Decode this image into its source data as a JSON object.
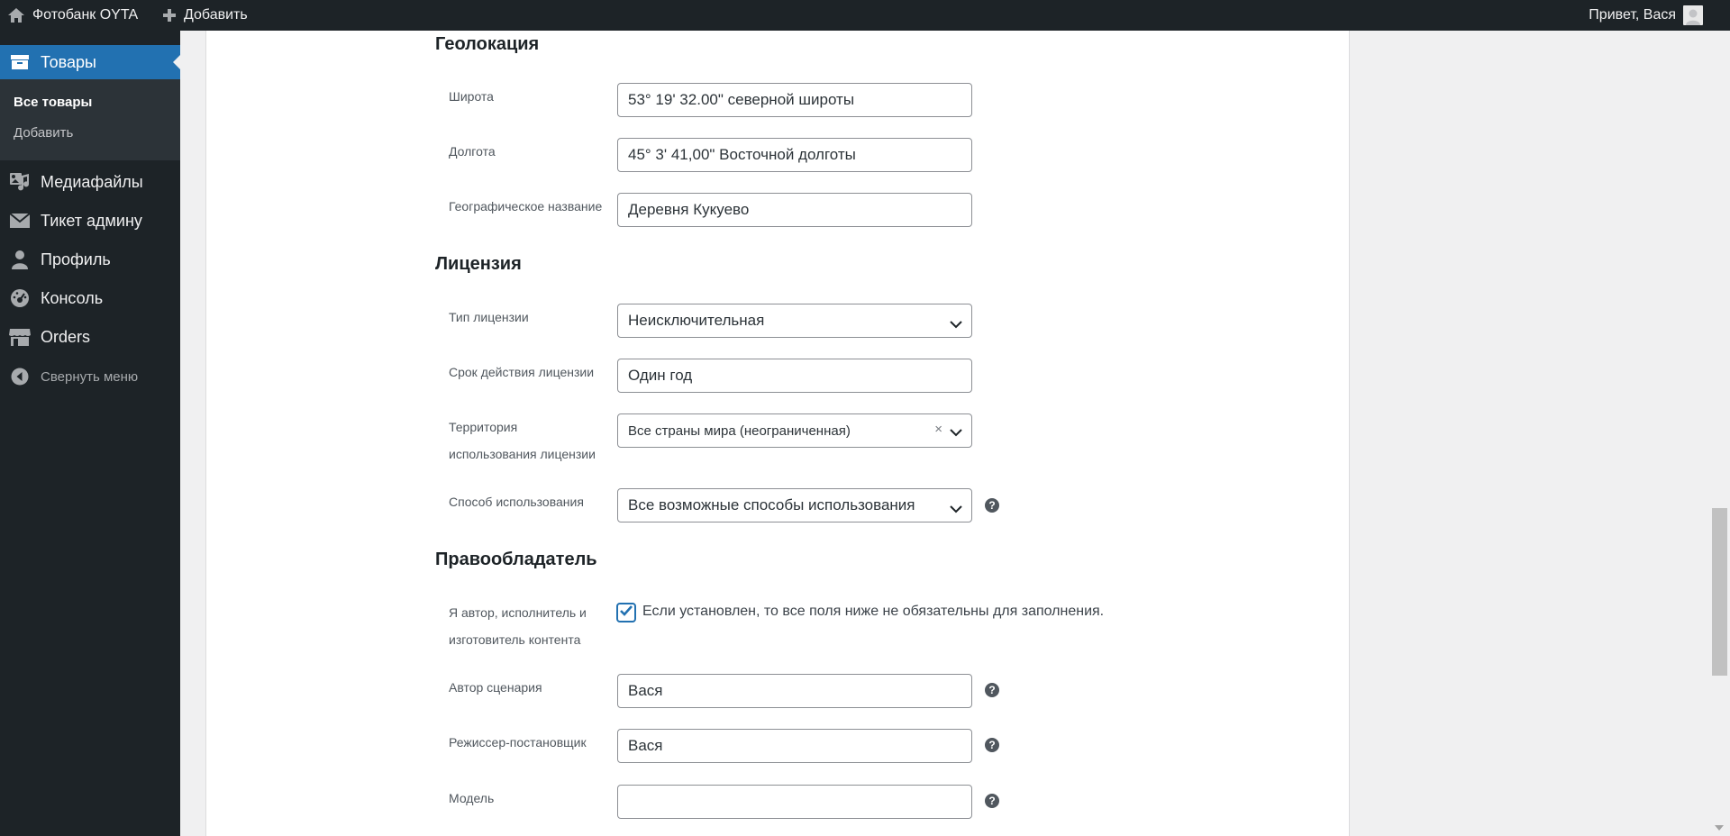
{
  "adminbar": {
    "site_name": "Фотобанк OYTA",
    "new_label": "Добавить",
    "greeting": "Привет, Вася"
  },
  "sidebar": {
    "current": {
      "label": "Товары",
      "icon": "archive-icon"
    },
    "submenu": [
      {
        "label": "Все товары",
        "current": true
      },
      {
        "label": "Добавить",
        "current": false
      }
    ],
    "items": [
      {
        "label": "Медиафайлы",
        "icon": "media-icon"
      },
      {
        "label": "Тикет админу",
        "icon": "email-icon"
      },
      {
        "label": "Профиль",
        "icon": "user-icon"
      },
      {
        "label": "Консоль",
        "icon": "dashboard-icon"
      },
      {
        "label": "Orders",
        "icon": "store-icon"
      }
    ],
    "collapse_label": "Свернуть меню"
  },
  "sections": {
    "geolocation": {
      "title": "Геолокация",
      "latitude": {
        "label": "Широта",
        "value": "53° 19' 32.00\" северной широты"
      },
      "longitude": {
        "label": "Долгота",
        "value": "45° 3' 41,00\" Восточной долготы"
      },
      "place_name": {
        "label": "Географическое название",
        "value": "Деревня Кукуево"
      }
    },
    "license": {
      "title": "Лицензия",
      "type": {
        "label": "Тип лицензии",
        "value": "Неисключительная"
      },
      "term": {
        "label": "Срок действия лицензии",
        "value": "Один год"
      },
      "territory": {
        "label_line1": "Территория",
        "label_line2": "использования лицензии",
        "value": "Все страны мира (неограниченная)",
        "clear": "×"
      },
      "usage": {
        "label": "Способ использования",
        "value": "Все возможные способы использования"
      }
    },
    "rightholder": {
      "title": "Правообладатель",
      "self_author": {
        "label_line1": "Я автор, исполнитель и",
        "label_line2": "изготовитель контента",
        "checked": true,
        "description": "Если установлен, то все поля ниже не обязательны для заполнения."
      },
      "screenwriter": {
        "label": "Автор сценария",
        "value": "Вася"
      },
      "director": {
        "label": "Режиссер-постановщик",
        "value": "Вася"
      },
      "model": {
        "label": "Модель",
        "value": ""
      }
    }
  },
  "help_glyph": "?",
  "colors": {
    "accent": "#2271b1",
    "sidebar_bg": "#1d2327"
  }
}
